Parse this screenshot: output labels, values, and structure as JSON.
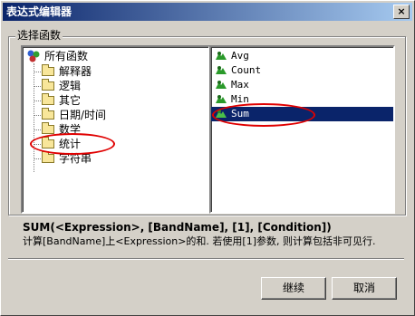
{
  "window": {
    "title": "表达式编辑器",
    "close_glyph": "×"
  },
  "group_label": "选择函数",
  "tree": {
    "root": "所有函数",
    "items": [
      "解释器",
      "逻辑",
      "其它",
      "日期/时间",
      "数学",
      "统计",
      "字符串"
    ],
    "selected_index": 5
  },
  "functions": {
    "items": [
      "Avg",
      "Count",
      "Max",
      "Min",
      "Sum"
    ],
    "selected_index": 4,
    "icon": "green-function-icon"
  },
  "description": {
    "signature": "SUM(<Expression>, [BandName], [1], [Condition])",
    "text": "计算[BandName]上<Expression>的和. 若使用[1]参数, 则计算包括非可见行."
  },
  "buttons": {
    "continue": "继续",
    "cancel": "取消"
  },
  "colors": {
    "title_bar": "#0a246a",
    "selection": "#0a246a",
    "annotation": "#e00000"
  }
}
